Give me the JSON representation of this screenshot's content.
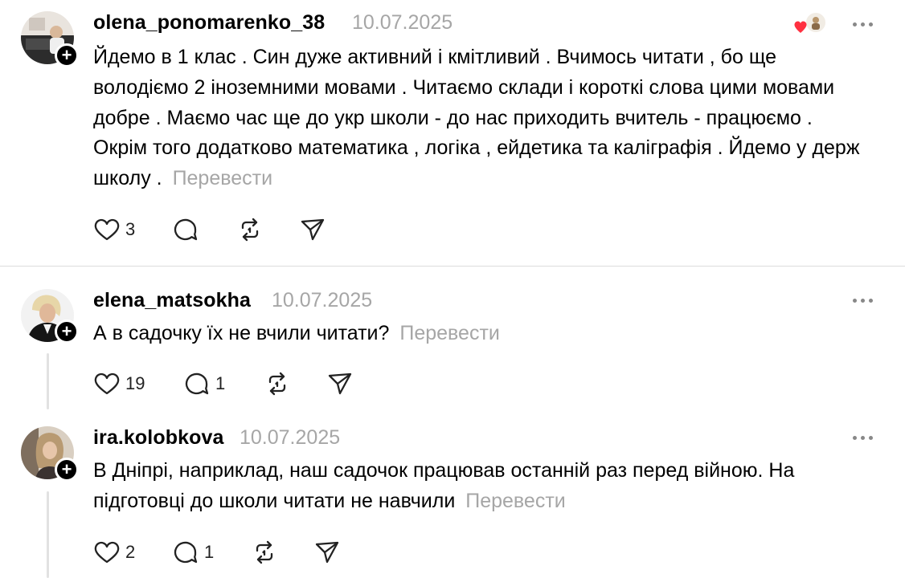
{
  "posts": [
    {
      "username": "olena_ponomarenko_38",
      "date": "10.07.2025",
      "text": "Йдемо в 1 клас . Син дуже активний і кмітливий . Вчимось читати , бо ще володіємо 2 іноземними мовами . Читаємо склади і короткі слова цими мовами добре . Маємо час ще до укр школи - до нас приходить вчитель - працюємо . Окрім того додатково математика , логіка , ейдетика та каліграфія . Йдемо у держ школу .",
      "translate": "Перевести",
      "likes": "3",
      "replies": ""
    },
    {
      "username": "elena_matsokha",
      "date": "10.07.2025",
      "text": "А в садочку їх не вчили читати?",
      "translate": "Перевести",
      "likes": "19",
      "replies": "1"
    },
    {
      "username": "ira.kolobkova",
      "date": "10.07.2025",
      "text": "В Дніпрі, наприклад, наш садочок працював останній раз перед війною. На підготовці до школи читати не навчили",
      "translate": "Перевести",
      "likes": "2",
      "replies": "1"
    }
  ],
  "colors": {
    "accent_heart": "#ff3040",
    "muted": "#a6a6a6"
  },
  "icons": [
    "heart-icon",
    "comment-icon",
    "repost-icon",
    "share-icon",
    "more-icon",
    "follow-plus-icon"
  ]
}
